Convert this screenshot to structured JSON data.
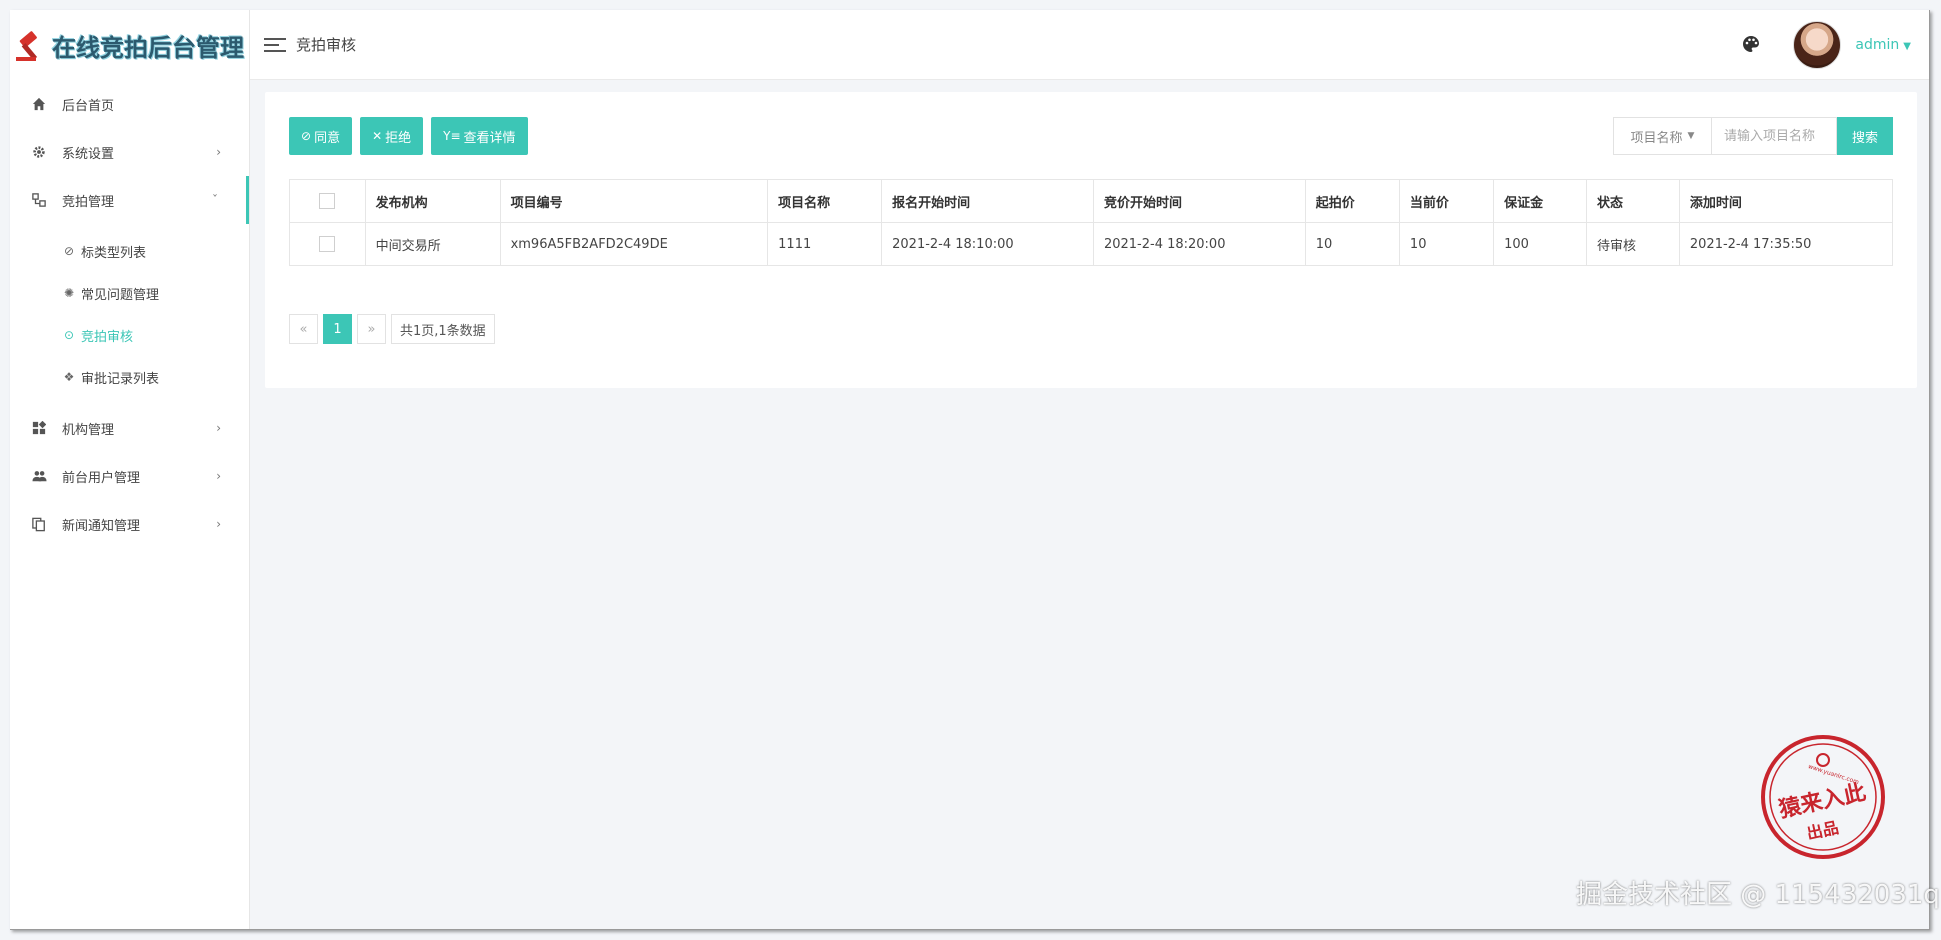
{
  "brand": {
    "title": "在线竞拍后台管理",
    "icon": "gavel-icon"
  },
  "sidebar": {
    "items": [
      {
        "label": "后台首页",
        "icon": "home-icon"
      },
      {
        "label": "系统设置",
        "icon": "gear-icon"
      },
      {
        "label": "竞拍管理",
        "icon": "sitemap-icon",
        "children": [
          {
            "label": "标类型列表",
            "icon": "circle-icon"
          },
          {
            "label": "常见问题管理",
            "icon": "bulb-icon"
          },
          {
            "label": "竞拍审核",
            "icon": "check-circle-icon"
          },
          {
            "label": "审批记录列表",
            "icon": "diamond-icon"
          }
        ]
      },
      {
        "label": "机构管理",
        "icon": "grid-icon"
      },
      {
        "label": "前台用户管理",
        "icon": "users-icon"
      },
      {
        "label": "新闻通知管理",
        "icon": "copy-icon"
      }
    ]
  },
  "header": {
    "page_title": "竞拍审核",
    "user_name": "admin"
  },
  "toolbar": {
    "approve_label": "同意",
    "reject_label": "拒绝",
    "detail_label": "查看详情"
  },
  "search": {
    "field_selected": "项目名称",
    "placeholder": "请输入项目名称",
    "button_label": "搜索"
  },
  "table": {
    "columns": [
      "发布机构",
      "项目编号",
      "项目名称",
      "报名开始时间",
      "竞价开始时间",
      "起拍价",
      "当前价",
      "保证金",
      "状态",
      "添加时间"
    ],
    "rows": [
      [
        "中间交易所",
        "xm96A5FB2AFD2C49DE",
        "1111",
        "2021-2-4 18:10:00",
        "2021-2-4 18:20:00",
        "10",
        "10",
        "100",
        "待审核",
        "2021-2-4 17:35:50"
      ]
    ]
  },
  "pagination": {
    "prev": "«",
    "current": "1",
    "next": "»",
    "info": "共1页,1条数据"
  },
  "watermark": {
    "stamp_text": "猿来入此",
    "stamp_sub": "出品",
    "stamp_url": "www.yuanlrc.com",
    "footer_text": "掘金技术社区 @ 115432031q"
  },
  "colors": {
    "accent": "#3cc6b6",
    "status_pending": "#1e9c4a",
    "stamp": "#c8252d"
  }
}
